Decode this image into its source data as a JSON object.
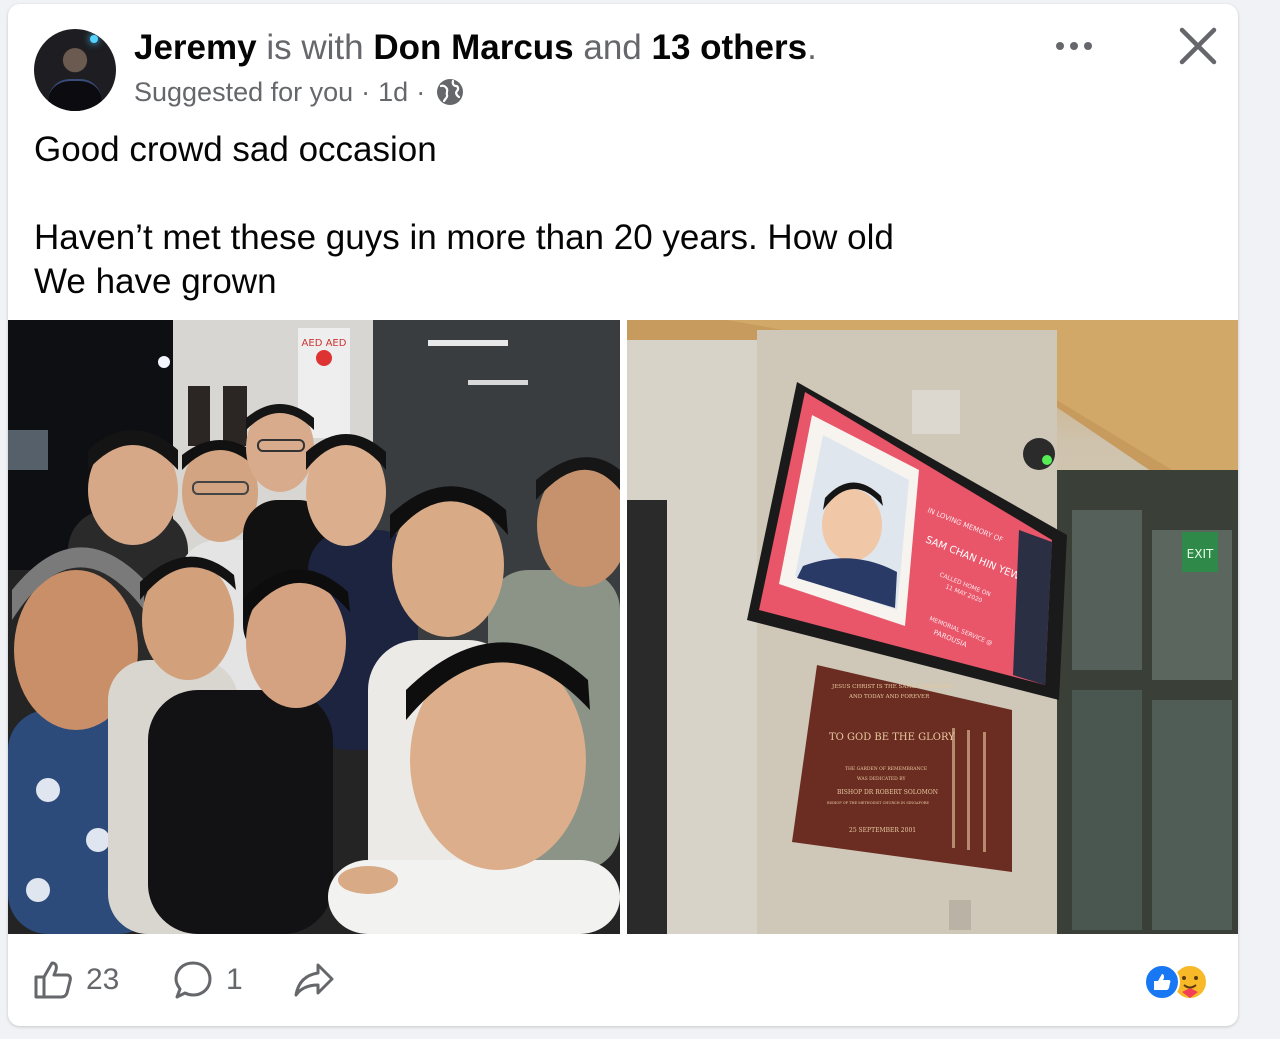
{
  "post": {
    "author": "Jeremy",
    "connector": " is with ",
    "tagged_person": "Don Marcus",
    "and_text": " and ",
    "others_text": "13 others",
    "period": ".",
    "suggested": "Suggested for you",
    "separator": "·",
    "time": "1d",
    "body": "Good crowd sad occasion\n\nHaven’t met these guys in more than 20 years. How old\nWe have grown"
  },
  "photos": {
    "left": {
      "signs": [
        "AED AED"
      ]
    },
    "right": {
      "screen_lines": [
        "IN LOVING MEMORY OF",
        "SAM CHAN HIN YEW",
        "CALLED HOME ON",
        "11 MAY 2020",
        "MEMORIAL SERVICE @",
        "PAROUSIA"
      ],
      "exit_sign": "EXIT",
      "plaque_lines": [
        "JESUS CHRIST IS THE SAME YESTERDAY",
        "AND TODAY AND FOREVER",
        "TO GOD BE THE GLORY",
        "THE GARDEN OF REMEMBRANCE",
        "WAS DEDICATED BY",
        "BISHOP DR ROBERT SOLOMON",
        "BISHOP OF THE METHODIST CHURCH IN SINGAPORE",
        "25 SEPTEMBER 2001"
      ]
    }
  },
  "footer": {
    "likes": "23",
    "comments": "1"
  },
  "icons": {
    "globe": "globe-icon",
    "more": "more-options-icon",
    "close": "close-icon",
    "like": "thumbs-up-icon",
    "comment": "comment-bubble-icon",
    "share": "share-arrow-icon",
    "reactions": [
      "like-reaction-icon",
      "care-reaction-icon"
    ]
  },
  "colors": {
    "text": "#050505",
    "muted": "#65676b",
    "like_blue": "#1877f2",
    "care_yellow": "#f7b928"
  }
}
